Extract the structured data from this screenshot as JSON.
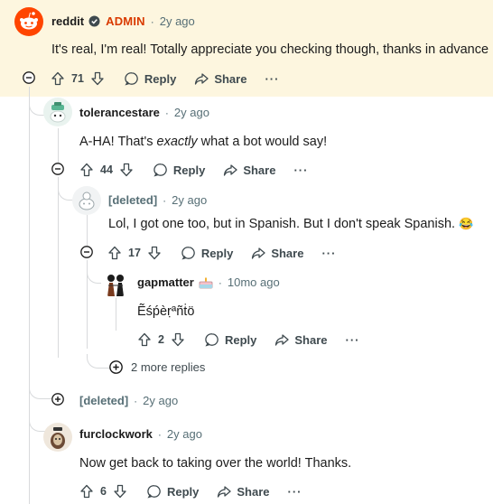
{
  "colors": {
    "highlight": "#fdf6df",
    "admin": "#d93a00",
    "reddit_orange": "#ff4500",
    "meta": "#576f76"
  },
  "comments": [
    {
      "author": "reddit",
      "badge": "ADMIN",
      "time": "2y ago",
      "body": "It's real, I'm real! Totally appreciate you checking though, thanks in advance",
      "votes": "71",
      "reply": "Reply",
      "share": "Share",
      "more": "···",
      "dot": "·"
    },
    {
      "author": "tolerancestare",
      "time": "2y ago",
      "body_pre": "A-HA! That's ",
      "body_em": "exactly",
      "body_post": " what a bot would say!",
      "votes": "44",
      "reply": "Reply",
      "share": "Share",
      "more": "···",
      "dot": "·"
    },
    {
      "author": "[deleted]",
      "time": "2y ago",
      "body": "Lol, I got one too, but in Spanish. But I don't speak Spanish.",
      "emoji": "😂",
      "votes": "17",
      "reply": "Reply",
      "share": "Share",
      "more": "···",
      "dot": "·"
    },
    {
      "author": "gapmatter",
      "flair_icon": "cake-icon",
      "time": "10mo ago",
      "body": "Ẽśṕèṛªñṫö",
      "votes": "2",
      "reply": "Reply",
      "share": "Share",
      "more": "···",
      "dot": "·"
    },
    {
      "author": "[deleted]",
      "time": "2y ago",
      "collapsed": true,
      "dot": "·"
    },
    {
      "author": "furclockwork",
      "time": "2y ago",
      "body": "Now get back to taking over the world! Thanks.",
      "votes": "6",
      "reply": "Reply",
      "share": "Share",
      "more": "···",
      "dot": "·"
    }
  ],
  "more_replies": "2 more replies"
}
